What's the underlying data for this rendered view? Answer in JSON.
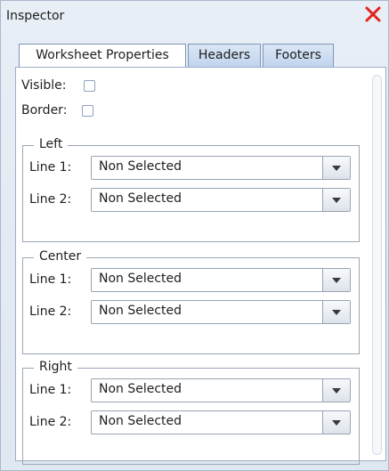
{
  "window": {
    "title": "Inspector"
  },
  "tabs": [
    {
      "label": "Worksheet Properties",
      "active": true
    },
    {
      "label": "Headers",
      "active": false
    },
    {
      "label": "Footers",
      "active": false
    }
  ],
  "properties": {
    "visible_label": "Visible:",
    "visible_checked": false,
    "border_label": "Border:",
    "border_checked": false
  },
  "groups": [
    {
      "title": "Left",
      "lines": [
        {
          "label": "Line 1:",
          "value": "Non Selected"
        },
        {
          "label": "Line 2:",
          "value": "Non Selected"
        }
      ]
    },
    {
      "title": "Center",
      "lines": [
        {
          "label": "Line 1:",
          "value": "Non Selected"
        },
        {
          "label": "Line 2:",
          "value": "Non Selected"
        }
      ]
    },
    {
      "title": "Right",
      "lines": [
        {
          "label": "Line 1:",
          "value": "Non Selected"
        },
        {
          "label": "Line 2:",
          "value": "Non Selected"
        }
      ]
    }
  ],
  "icons": {
    "close": "close-icon",
    "dropdown": "chevron-down-icon"
  },
  "colors": {
    "close": "#e0241b",
    "tab_active": "#ffffff",
    "tab_inactive": "#c9d9f0"
  }
}
